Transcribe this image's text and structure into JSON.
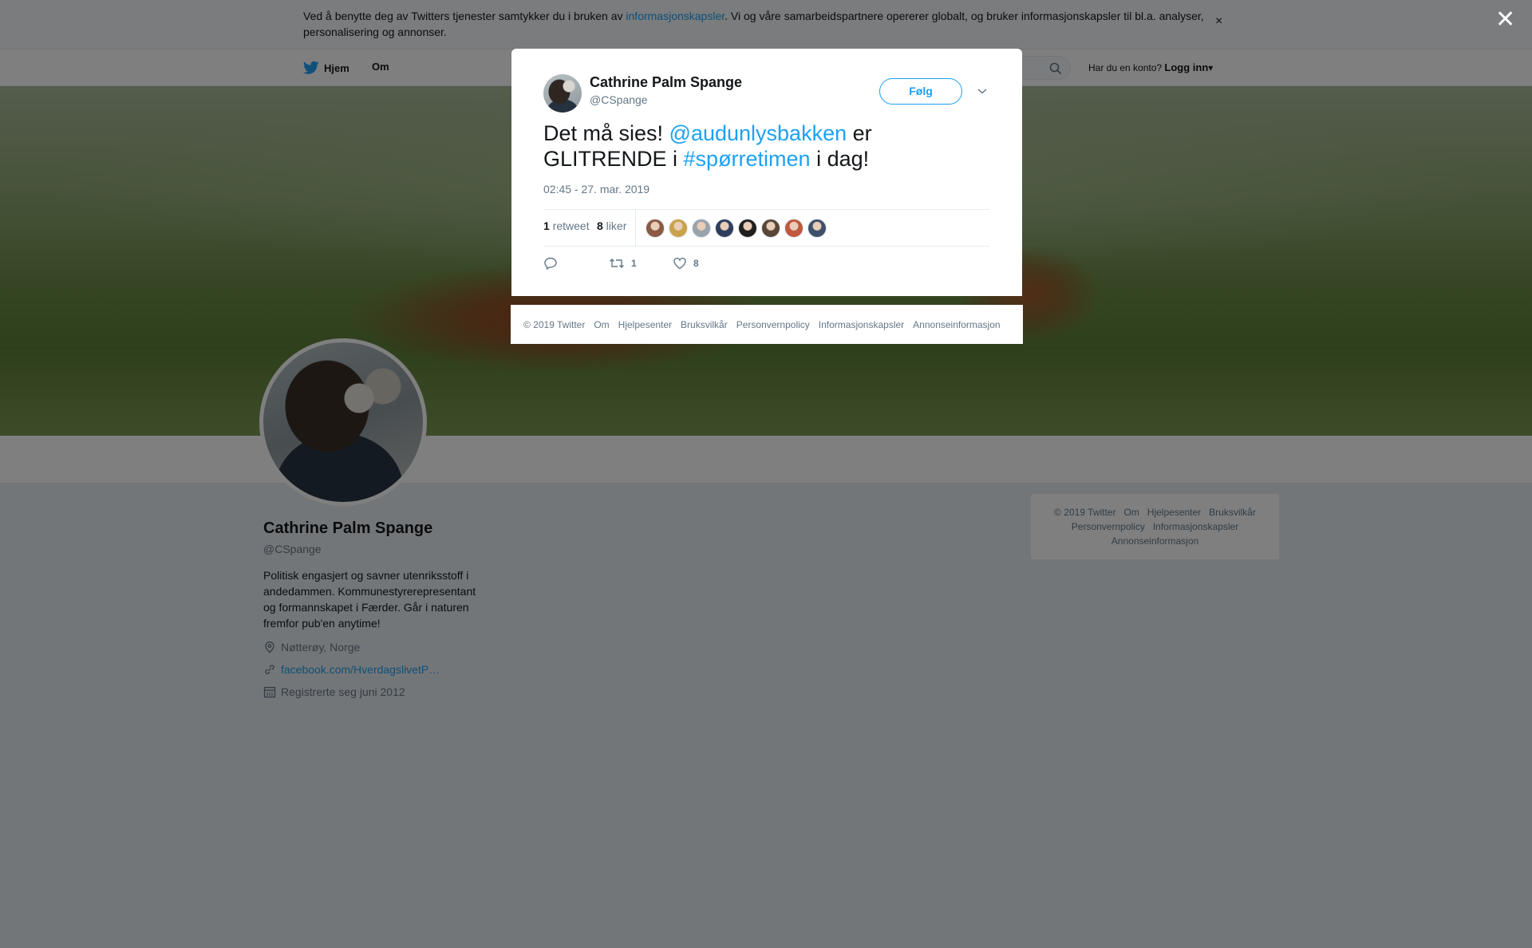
{
  "cookie": {
    "text_before": "Ved å benytte deg av Twitters tjenester samtykker du i bruken av ",
    "link": "informasjonskapsler",
    "text_after": ". Vi og våre samarbeidspartnere opererer globalt, og bruker informasjonskapsler til bl.a. analyser, personalisering og annonser.",
    "close": "×"
  },
  "nav": {
    "home": "Hjem",
    "about": "Om",
    "login_prompt": "Har du en konto?",
    "login": "Logg inn"
  },
  "profile": {
    "name": "Cathrine Palm Spange",
    "handle": "@CSpange",
    "bio": "Politisk engasjert og savner utenriksstoff i andedammen. Kommunestyrerepresentant og formannskapet i Færder. Går i naturen fremfor pub'en anytime!",
    "location": "Nøtterøy, Norge",
    "website": "facebook.com/HverdagslivetP…",
    "joined": "Registrerte seg juni 2012"
  },
  "side_footer": {
    "items": [
      "© 2019 Twitter",
      "Om",
      "Hjelpesenter",
      "Bruksvilkår",
      "Personvernpolicy",
      "Informasjonskapsler",
      "Annonseinformasjon"
    ]
  },
  "overlay_close": "✕",
  "tweet": {
    "name": "Cathrine Palm Spange",
    "handle": "@CSpange",
    "follow": "Følg",
    "text_1": "Det må sies! ",
    "mention": "@audunlysbakken",
    "text_2": " er GLITRENDE i ",
    "hashtag": "#spørretimen",
    "text_3": " i dag!",
    "time": "02:45 - 27. mar. 2019",
    "retweets_count": "1",
    "retweets_label": " retweet",
    "likes_count": "8",
    "likes_label": " liker",
    "liker_colors": [
      "#8a5a44",
      "#c9a24a",
      "#9aa3ab",
      "#2d3e5c",
      "#1f1f1f",
      "#5a4636",
      "#c0583e",
      "#3f4f6a"
    ],
    "action_retweet_count": "1",
    "action_like_count": "8"
  },
  "modal_footer": {
    "items": [
      "© 2019 Twitter",
      "Om",
      "Hjelpesenter",
      "Bruksvilkår",
      "Personvernpolicy",
      "Informasjonskapsler",
      "Annonseinformasjon"
    ]
  }
}
